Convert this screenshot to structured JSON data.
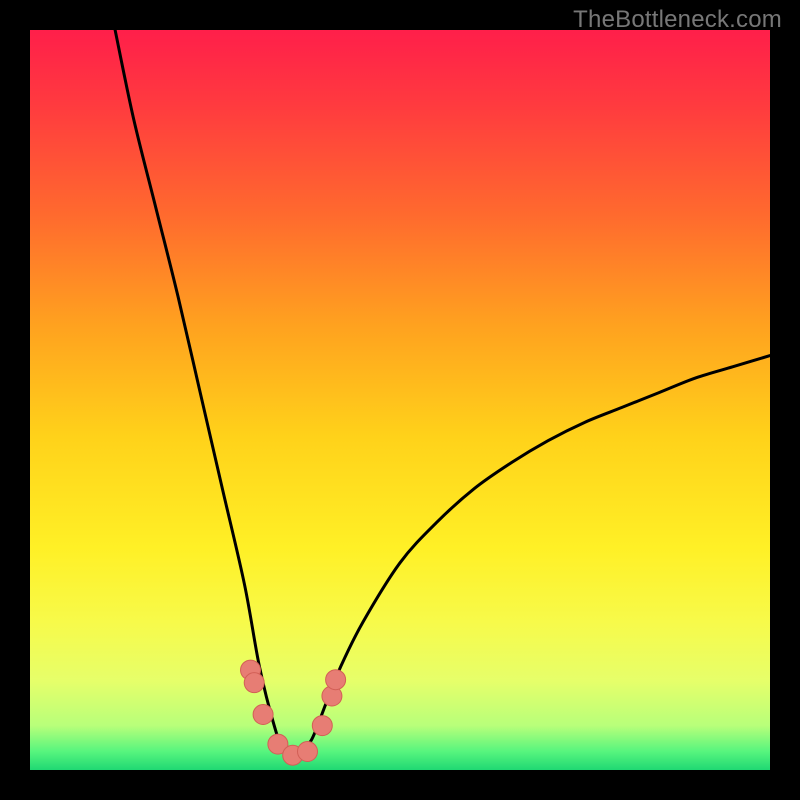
{
  "watermark": "TheBottleneck.com",
  "colors": {
    "frame": "#000000",
    "curve": "#000000",
    "marker_fill": "#e77d74",
    "marker_stroke": "#d25f56",
    "green_band": "#2fe67a",
    "gradient_stops": [
      {
        "offset": 0.0,
        "color": "#ff1f4a"
      },
      {
        "offset": 0.1,
        "color": "#ff3a3f"
      },
      {
        "offset": 0.25,
        "color": "#ff6a2e"
      },
      {
        "offset": 0.4,
        "color": "#ffa21f"
      },
      {
        "offset": 0.55,
        "color": "#ffd21a"
      },
      {
        "offset": 0.7,
        "color": "#fff026"
      },
      {
        "offset": 0.8,
        "color": "#f7fa4a"
      },
      {
        "offset": 0.88,
        "color": "#e6ff6a"
      },
      {
        "offset": 0.94,
        "color": "#b8ff7a"
      },
      {
        "offset": 0.975,
        "color": "#57f57e"
      },
      {
        "offset": 1.0,
        "color": "#1fd873"
      }
    ]
  },
  "chart_data": {
    "type": "line",
    "title": "",
    "xlabel": "",
    "ylabel": "",
    "xlim": [
      0,
      100
    ],
    "ylim": [
      0,
      100
    ],
    "notes": "V-shaped bottleneck curve; minimum near x≈35 where y≈2. Left branch descends from top edge at x≈11.5; right branch ascends to y≈56 at x=100.",
    "series": [
      {
        "name": "bottleneck-curve",
        "x": [
          11.5,
          14,
          17,
          20,
          23,
          26,
          29,
          31,
          33,
          34.5,
          36,
          38,
          40,
          42,
          45,
          50,
          55,
          60,
          65,
          70,
          75,
          80,
          85,
          90,
          95,
          100
        ],
        "y": [
          100,
          88,
          76,
          64,
          51,
          38,
          25,
          14,
          6,
          2,
          2,
          4,
          9,
          14,
          20,
          28,
          33.5,
          38,
          41.5,
          44.5,
          47,
          49,
          51,
          53,
          54.5,
          56
        ]
      }
    ],
    "markers": {
      "name": "highlighted-points",
      "x": [
        29.8,
        30.3,
        31.5,
        33.5,
        35.5,
        37.5,
        39.5,
        40.8,
        41.3
      ],
      "y": [
        13.5,
        11.8,
        7.5,
        3.5,
        2.0,
        2.5,
        6.0,
        10.0,
        12.2
      ]
    }
  }
}
